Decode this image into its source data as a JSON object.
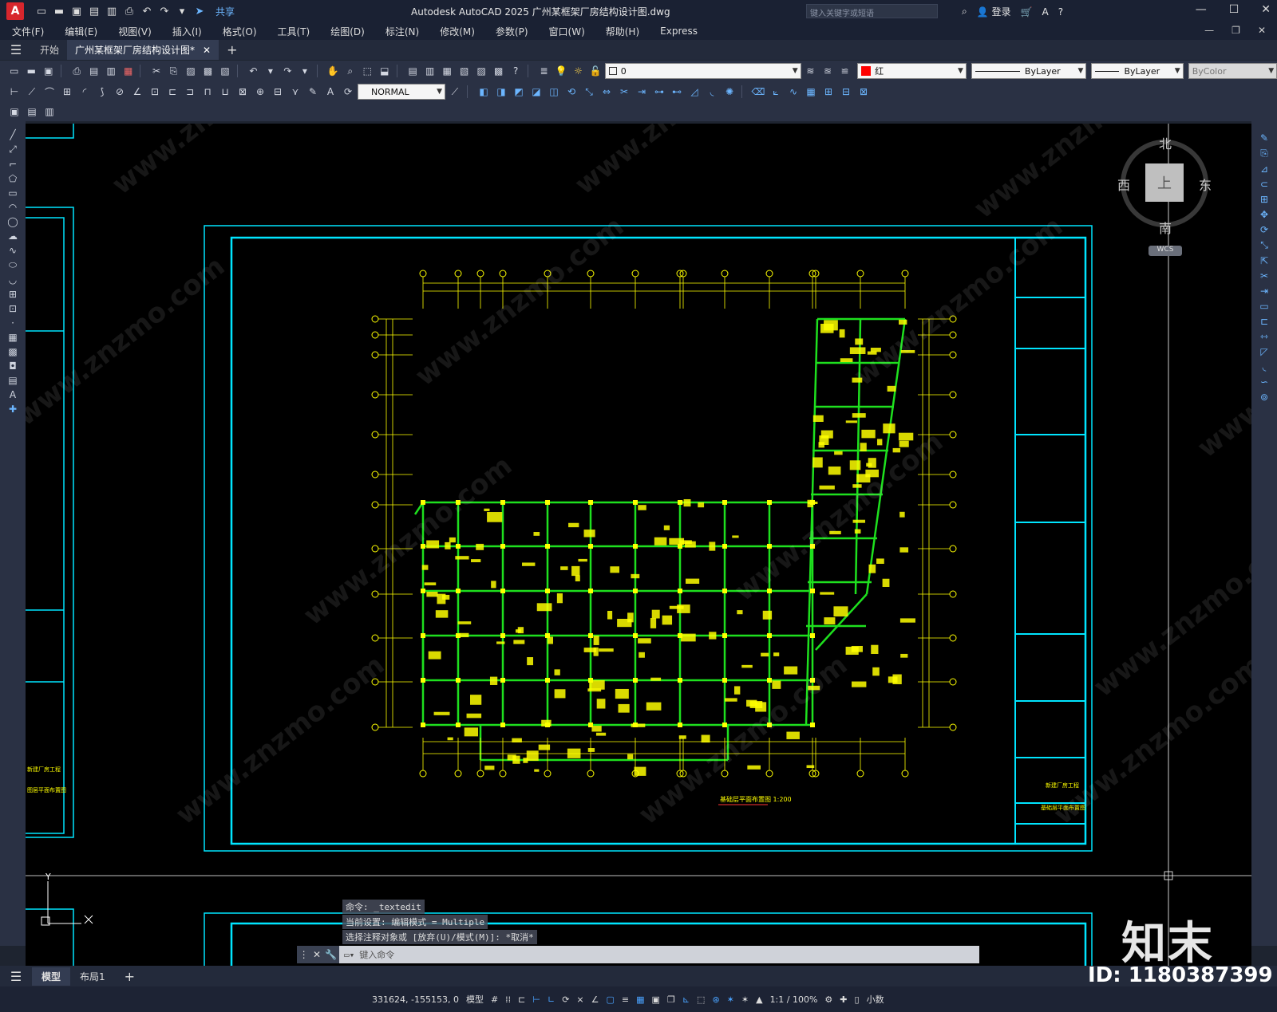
{
  "app": {
    "logo_letter": "A",
    "title": "Autodesk AutoCAD 2025    广州某框架厂房结构设计图.dwg",
    "share_label": "共享",
    "search_placeholder": "键入关键字或短语",
    "login_label": "登录"
  },
  "menu": [
    "文件(F)",
    "编辑(E)",
    "视图(V)",
    "插入(I)",
    "格式(O)",
    "工具(T)",
    "绘图(D)",
    "标注(N)",
    "修改(M)",
    "参数(P)",
    "窗口(W)",
    "帮助(H)",
    "Express"
  ],
  "tabs": {
    "start": "开始",
    "active": "广州某框架厂房结构设计图*"
  },
  "properties": {
    "layer": "0",
    "color": "红",
    "color_hex": "#ff0000",
    "linetype": "ByLayer",
    "lineweight": "ByLayer",
    "plotstyle": "ByColor",
    "dimstyle": "NORMAL"
  },
  "viewcube": {
    "north": "北",
    "south": "南",
    "east": "东",
    "west": "西",
    "top": "上",
    "wcs": "WCS"
  },
  "command_history": [
    "命令: _textedit",
    "当前设置: 编辑模式 = Multiple",
    "选择注释对象或 [放弃(U)/模式(M)]: *取消*"
  ],
  "command_placeholder": "键入命令",
  "layout_tabs": {
    "model": "模型",
    "layout1": "布局1"
  },
  "status": {
    "coords": "331624, -155153, 0",
    "model_label": "模型",
    "scale": "1:1 / 100%",
    "units": "小数"
  },
  "drawing": {
    "title_block_project": "新建厂房工程",
    "title_block_sheet": "基础层平面布置图",
    "plan_title": "基础层平面布置图 1:200",
    "left_project": "新建厂房工程",
    "left_sheet": "图层平面布置图"
  },
  "watermark": {
    "site": "www.znzmo.com",
    "brand": "知末",
    "id": "ID: 1180387399"
  },
  "colors": {
    "frame": "#00e5ff",
    "beam": "#1ee01e",
    "text": "#ffff00",
    "background": "#000000"
  }
}
